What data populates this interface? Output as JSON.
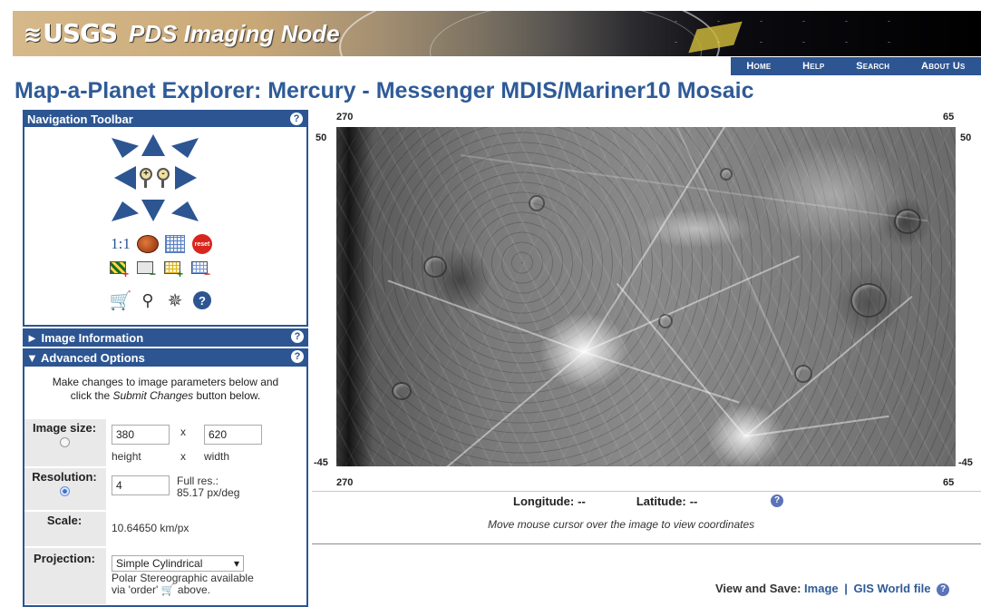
{
  "header": {
    "logo_text": "USGS",
    "site_title": "PDS Imaging Node"
  },
  "topnav": {
    "items": [
      "Home",
      "Help",
      "Search",
      "About Us"
    ]
  },
  "page": {
    "title": "Map-a-Planet Explorer: Mercury - Messenger MDIS/Mariner10 Mosaic"
  },
  "nav_toolbar": {
    "title": "Navigation Toolbar",
    "help": "?",
    "scale_one_label": "1:1",
    "reset_label": "reset",
    "zoom_in": "+",
    "zoom_out": "-",
    "help_icon": "?"
  },
  "image_info": {
    "title": "► Image Information",
    "help": "?"
  },
  "advanced": {
    "title": "▼ Advanced Options",
    "help": "?",
    "intro_line1": "Make changes to image parameters below and",
    "intro_line2_prefix": "click the ",
    "intro_line2_em": "Submit Changes",
    "intro_line2_suffix": " button below.",
    "image_size_label": "Image size:",
    "height_value": "380",
    "times": "x",
    "width_value": "620",
    "height_caption": "height",
    "width_caption": "width",
    "resolution_label": "Resolution:",
    "resolution_value": "4",
    "full_res_line1": "Full res.:",
    "full_res_line2": "85.17 px/deg",
    "scale_label": "Scale:",
    "scale_value": "10.64650 km/px",
    "projection_label": "Projection:",
    "projection_value": "Simple Cylindrical",
    "projection_note_line1": "Polar Stereographic available",
    "projection_note_line2": "via 'order'",
    "projection_note_line3": "above."
  },
  "map": {
    "top_left": "270",
    "top_right": "65",
    "left_top": "50",
    "right_top": "50",
    "left_bottom": "-45",
    "right_bottom": "-45",
    "bottom_left": "270",
    "bottom_right": "65"
  },
  "coords": {
    "longitude_label": "Longitude:",
    "longitude_value": "--",
    "latitude_label": "Latitude:",
    "latitude_value": "--",
    "help": "?",
    "hint": "Move mouse cursor over the image to view coordinates"
  },
  "view_save": {
    "label": "View and Save:",
    "image_link": "Image",
    "separator": "|",
    "gis_link": "GIS World file",
    "help": "?"
  },
  "colors": {
    "accent_blue": "#2c5592",
    "title_blue": "#2f5b97"
  }
}
